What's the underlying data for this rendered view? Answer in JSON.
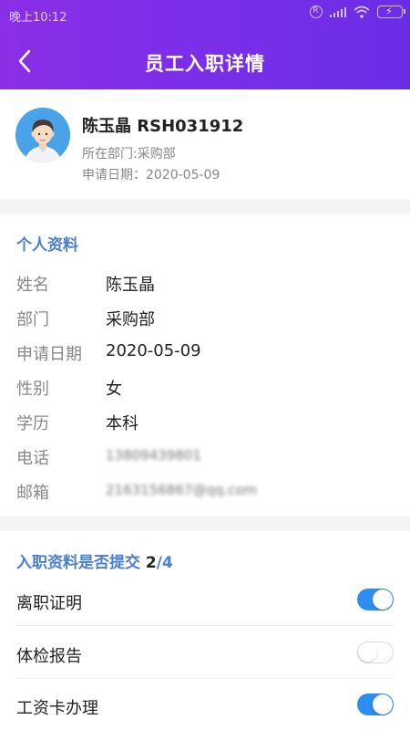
{
  "status_bar": {
    "time": "晚上10:12",
    "icons": [
      "r-icon",
      "signal-icon",
      "wifi-icon",
      "battery-charging-icon"
    ]
  },
  "nav": {
    "title": "员工入职详情",
    "back_icon": "chevron-left-icon"
  },
  "profile": {
    "name_id": "陈玉晶 RSH031912",
    "department": "所在部门:采购部",
    "apply_date": "申请日期：2020-05-09"
  },
  "personal": {
    "title": "个人资料",
    "rows": [
      {
        "label": "姓名",
        "value": "陈玉晶"
      },
      {
        "label": "部门",
        "value": "采购部"
      },
      {
        "label": "申请日期",
        "value": "2020-05-09"
      },
      {
        "label": "性别",
        "value": "女"
      },
      {
        "label": "学历",
        "value": "本科"
      },
      {
        "label": "电话",
        "value": "13809439801"
      },
      {
        "label": "邮箱",
        "value": "2163156867@qq.com"
      }
    ]
  },
  "documents": {
    "title": "入职资料是否提交",
    "submitted": "2",
    "separator": "/",
    "total": "4",
    "items": [
      {
        "label": "离职证明",
        "on": true
      },
      {
        "label": "体检报告",
        "on": false
      },
      {
        "label": "工资卡办理",
        "on": true
      }
    ]
  },
  "colors": {
    "header_start": "#8a2fe6",
    "header_end": "#6a2de6",
    "section_title": "#4a7fd0",
    "toggle_on": "#2d8ef0"
  }
}
